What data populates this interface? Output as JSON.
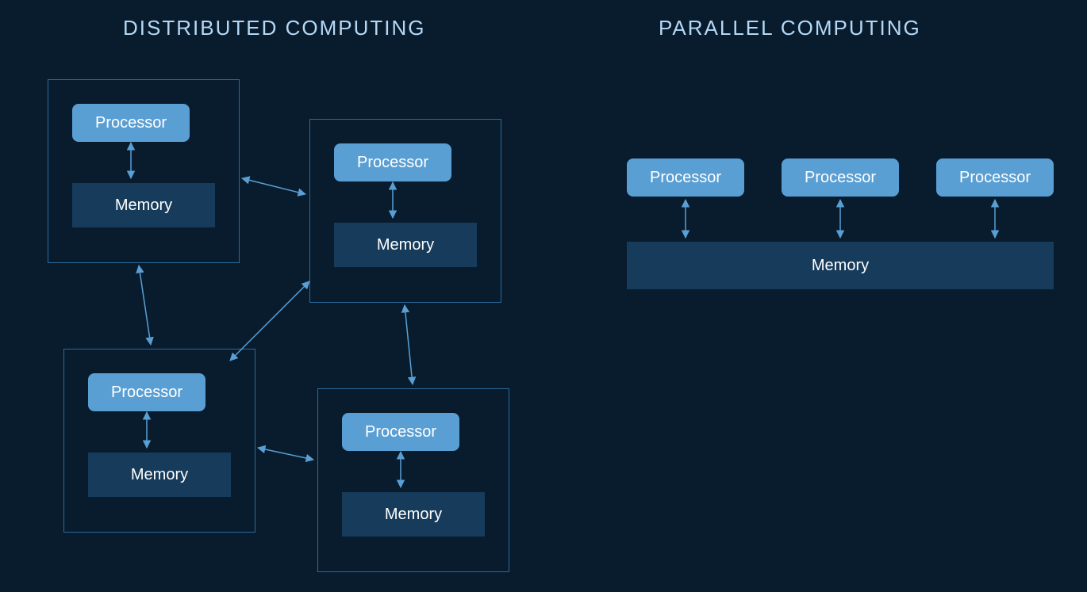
{
  "titles": {
    "left": "DISTRIBUTED COMPUTING",
    "right": "PARALLEL COMPUTING"
  },
  "labels": {
    "processor": "Processor",
    "memory": "Memory"
  },
  "colors": {
    "background": "#081c2e",
    "title_text": "#b5d8f5",
    "processor_box": "#5a9fd4",
    "memory_box": "#163b5b",
    "node_border": "#2b6a9b",
    "arrow": "#5a9fd4"
  },
  "distributed": {
    "node_count": 4,
    "connections": [
      [
        0,
        1
      ],
      [
        0,
        2
      ],
      [
        1,
        2
      ],
      [
        1,
        3
      ],
      [
        2,
        3
      ]
    ]
  },
  "parallel": {
    "processor_count": 3,
    "shared_memory": true
  }
}
